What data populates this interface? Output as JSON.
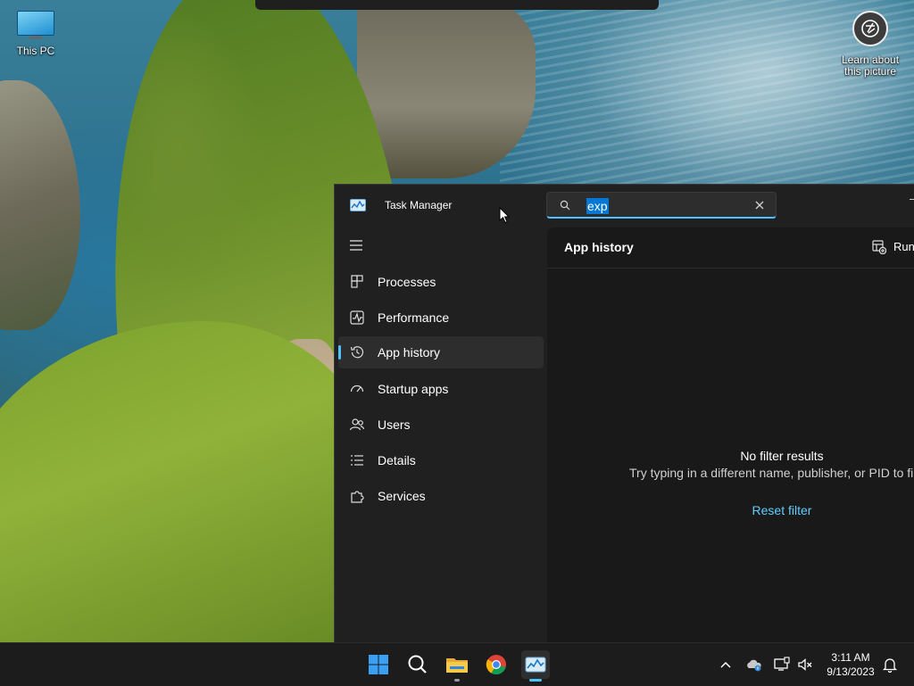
{
  "desktop": {
    "this_pc_label": "This PC",
    "learn_label_1": "Learn about",
    "learn_label_2": "this picture"
  },
  "window": {
    "title": "Task Manager",
    "search": {
      "value": "exp",
      "placeholder": ""
    }
  },
  "nav": {
    "items": [
      {
        "label": "Processes"
      },
      {
        "label": "Performance"
      },
      {
        "label": "App history"
      },
      {
        "label": "Startup apps"
      },
      {
        "label": "Users"
      },
      {
        "label": "Details"
      },
      {
        "label": "Services"
      }
    ],
    "active": "App history"
  },
  "main": {
    "title": "App history",
    "run_button": "Run",
    "empty_title": "No filter results",
    "empty_subtitle": "Try typing in a different name, publisher, or PID to fi",
    "reset_link": "Reset filter"
  },
  "taskbar": {
    "time": "3:11 AM",
    "date": "9/13/2023"
  },
  "colors": {
    "accent": "#4cc2ff",
    "link": "#60cdff",
    "window_bg": "#202020",
    "content_bg": "#191919",
    "taskbar_bg": "#1c1c1c"
  }
}
